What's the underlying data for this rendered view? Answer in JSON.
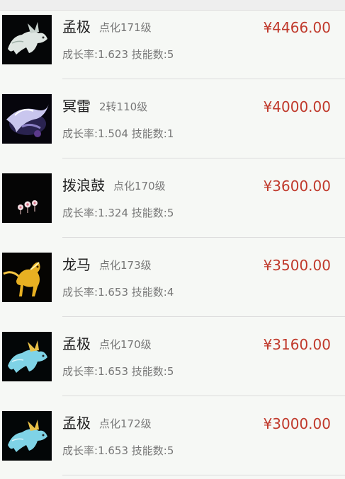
{
  "listings": [
    {
      "name": "孟极",
      "level": "点化171级",
      "growth_label": "成长率:",
      "growth": "1.623",
      "skills_label": "技能数:",
      "skills": "5",
      "price": "¥4466.00",
      "icon": "white-beast-icon"
    },
    {
      "name": "冥雷",
      "level": "2转110级",
      "growth_label": "成长率:",
      "growth": "1.504",
      "skills_label": "技能数:",
      "skills": "1",
      "price": "¥4000.00",
      "icon": "lightning-creature-icon"
    },
    {
      "name": "拨浪鼓",
      "level": "点化170级",
      "growth_label": "成长率:",
      "growth": "1.324",
      "skills_label": "技能数:",
      "skills": "5",
      "price": "¥3600.00",
      "icon": "rattle-drum-icon"
    },
    {
      "name": "龙马",
      "level": "点化173级",
      "growth_label": "成长率:",
      "growth": "1.653",
      "skills_label": "技能数:",
      "skills": "4",
      "price": "¥3500.00",
      "icon": "golden-horse-icon"
    },
    {
      "name": "孟极",
      "level": "点化170级",
      "growth_label": "成长率:",
      "growth": "1.653",
      "skills_label": "技能数:",
      "skills": "5",
      "price": "¥3160.00",
      "icon": "blue-beast-icon"
    },
    {
      "name": "孟极",
      "level": "点化172级",
      "growth_label": "成长率:",
      "growth": "1.653",
      "skills_label": "技能数:",
      "skills": "5",
      "price": "¥3000.00",
      "icon": "blue-beast-icon"
    }
  ],
  "colors": {
    "price": "#c0392b",
    "name": "#222222",
    "meta": "#777777"
  }
}
